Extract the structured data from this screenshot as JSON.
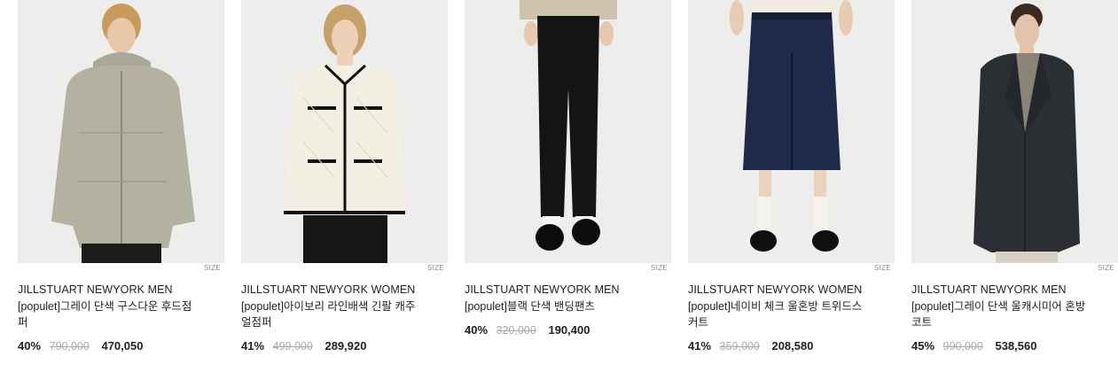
{
  "products": [
    {
      "brand": "JILLSTUART NEWYORK MEN",
      "name": "[populet]그레이 단색 구스다운 후드점퍼",
      "discount": "40%",
      "original_price": "790,000",
      "sale_price": "470,050",
      "size_label": "SIZE",
      "item_color": "#b3b19f"
    },
    {
      "brand": "JILLSTUART NEWYORK WOMEN",
      "name": "[populet]아이보리 라인배색 긴팔 캐주얼점퍼",
      "discount": "41%",
      "original_price": "499,000",
      "sale_price": "289,920",
      "size_label": "SIZE",
      "item_color": "#f3efe2"
    },
    {
      "brand": "JILLSTUART NEWYORK MEN",
      "name": "[populet]블랙 단색 밴딩팬츠",
      "discount": "40%",
      "original_price": "320,000",
      "sale_price": "190,400",
      "size_label": "SIZE",
      "item_color": "#141414"
    },
    {
      "brand": "JILLSTUART NEWYORK WOMEN",
      "name": "[populet]네이비 체크 울혼방 트위드스커트",
      "discount": "41%",
      "original_price": "359,000",
      "sale_price": "208,580",
      "size_label": "SIZE",
      "item_color": "#1f2a4a"
    },
    {
      "brand": "JILLSTUART NEWYORK MEN",
      "name": "[populet]그레이 단색 울캐시미어 혼방 코트",
      "discount": "45%",
      "original_price": "990,000",
      "sale_price": "538,560",
      "size_label": "SIZE",
      "item_color": "#2b2e33"
    }
  ]
}
